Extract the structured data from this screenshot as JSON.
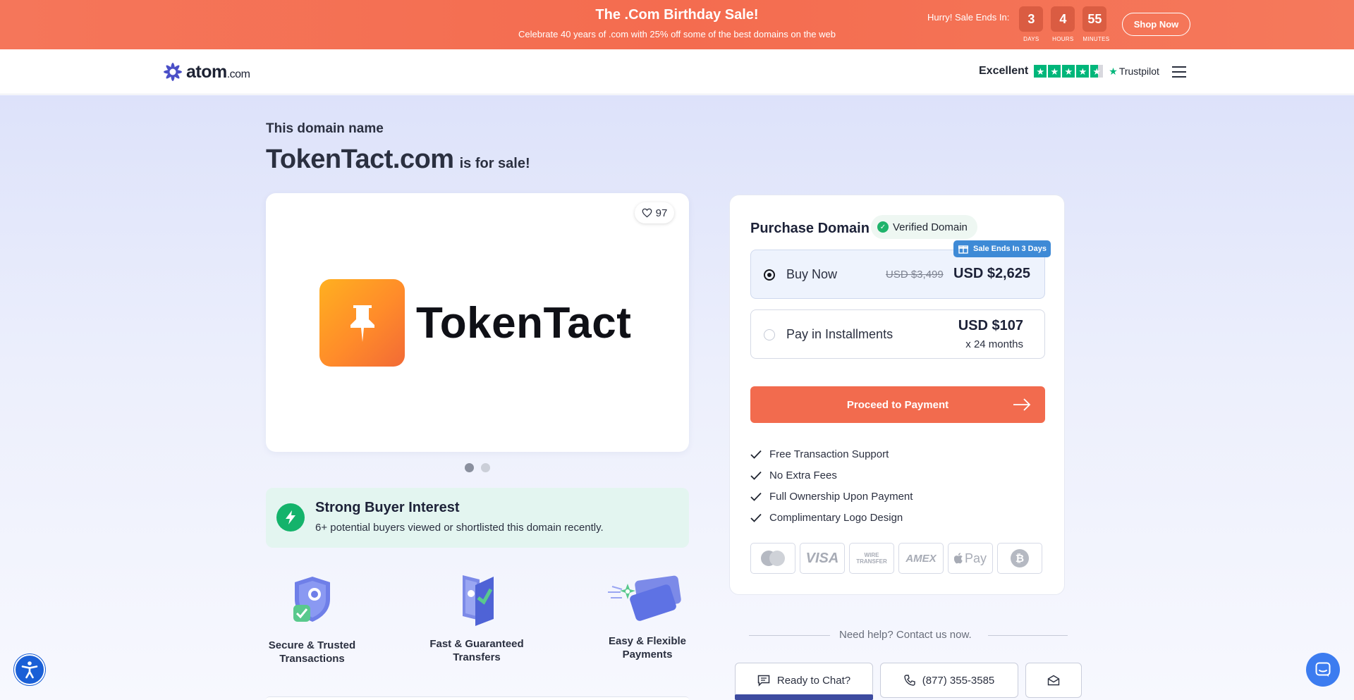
{
  "promo": {
    "title": "The .Com Birthday Sale!",
    "subtitle": "Celebrate 40 years of .com with 25% off some of the best domains on the web",
    "countdown_label": "Hurry! Sale Ends In:",
    "countdown": [
      {
        "value": "3",
        "unit": "DAYS"
      },
      {
        "value": "4",
        "unit": "HOURS"
      },
      {
        "value": "55",
        "unit": "MINUTES"
      }
    ],
    "cta": "Shop Now",
    "color": "#f46c4f"
  },
  "header": {
    "logo_name": "atom",
    "logo_tld": ".com",
    "rating_word": "Excellent",
    "rating_stars": 4.5,
    "trustpilot": "Trustpilot",
    "menu_icon": "hamburger-icon"
  },
  "listing": {
    "eyebrow": "This domain name",
    "domain": "TokenTact.com",
    "for_sale": "is for sale!",
    "likes": "97",
    "brand_name": "TokenTact",
    "brand_icon": "pushpin-icon",
    "carousel_pages": 2,
    "carousel_active": 1
  },
  "interest": {
    "title": "Strong Buyer Interest",
    "subtitle": "6+ potential buyers viewed or shortlisted this domain recently."
  },
  "features": [
    {
      "label_line1": "Secure & Trusted",
      "label_line2": "Transactions",
      "icon": "shield-check-icon"
    },
    {
      "label_line1": "Fast & Guaranteed",
      "label_line2": "Transfers",
      "icon": "transfer-icon"
    },
    {
      "label_line1": "Easy & Flexible",
      "label_line2": "Payments",
      "icon": "credit-card-icon"
    }
  ],
  "purchase": {
    "title": "Purchase Domain",
    "verified": "Verified Domain",
    "sale_tag": "Sale Ends In 3 Days",
    "buy_now": {
      "label": "Buy Now",
      "old_price": "USD $3,499",
      "price": "USD $2,625"
    },
    "installments": {
      "label": "Pay in Installments",
      "price": "USD $107",
      "term": "x 24 months"
    },
    "proceed": "Proceed to Payment",
    "benefits": [
      "Free Transaction Support",
      "No Extra Fees",
      "Full Ownership Upon Payment",
      "Complimentary Logo Design"
    ],
    "payment_methods": [
      {
        "name": "mastercard-icon",
        "label": ""
      },
      {
        "name": "visa-icon",
        "label": "VISA"
      },
      {
        "name": "wire-transfer-icon",
        "label": "WIRE TRANSFER"
      },
      {
        "name": "amex-icon",
        "label": "AMEX"
      },
      {
        "name": "apple-pay-icon",
        "label": "Pay"
      },
      {
        "name": "bitcoin-icon",
        "label": "₿"
      }
    ]
  },
  "help": {
    "text": "Need help? Contact us now.",
    "chat": "Ready to Chat?",
    "phone": "(877) 355-3585"
  }
}
